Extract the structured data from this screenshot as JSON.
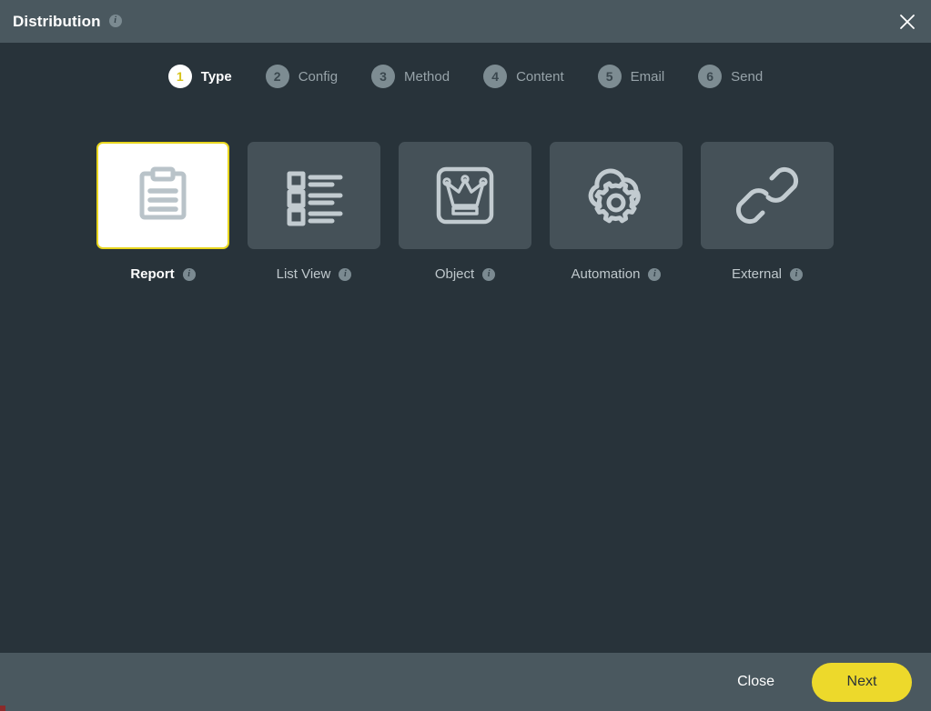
{
  "window": {
    "title": "Distribution",
    "title_info_icon": "info-icon",
    "close_icon": "close-icon",
    "header_color": "#4a585f",
    "body_color": "#28333a",
    "accent_color": "#edd92b"
  },
  "wizard": {
    "steps": [
      {
        "number": "1",
        "label": "Type",
        "active": true
      },
      {
        "number": "2",
        "label": "Config",
        "active": false
      },
      {
        "number": "3",
        "label": "Method",
        "active": false
      },
      {
        "number": "4",
        "label": "Content",
        "active": false
      },
      {
        "number": "5",
        "label": "Email",
        "active": false
      },
      {
        "number": "6",
        "label": "Send",
        "active": false
      }
    ]
  },
  "type_cards": [
    {
      "label": "Report",
      "icon": "clipboard-icon",
      "selected": true,
      "info_icon": "info-icon"
    },
    {
      "label": "List View",
      "icon": "list-view-icon",
      "selected": false,
      "info_icon": "info-icon"
    },
    {
      "label": "Object",
      "icon": "crown-in-square-icon",
      "selected": false,
      "info_icon": "info-icon"
    },
    {
      "label": "Automation",
      "icon": "cloud-gear-icon",
      "selected": false,
      "info_icon": "info-icon"
    },
    {
      "label": "External",
      "icon": "link-chain-icon",
      "selected": false,
      "info_icon": "info-icon"
    }
  ],
  "footer": {
    "close_label": "Close",
    "next_label": "Next"
  }
}
